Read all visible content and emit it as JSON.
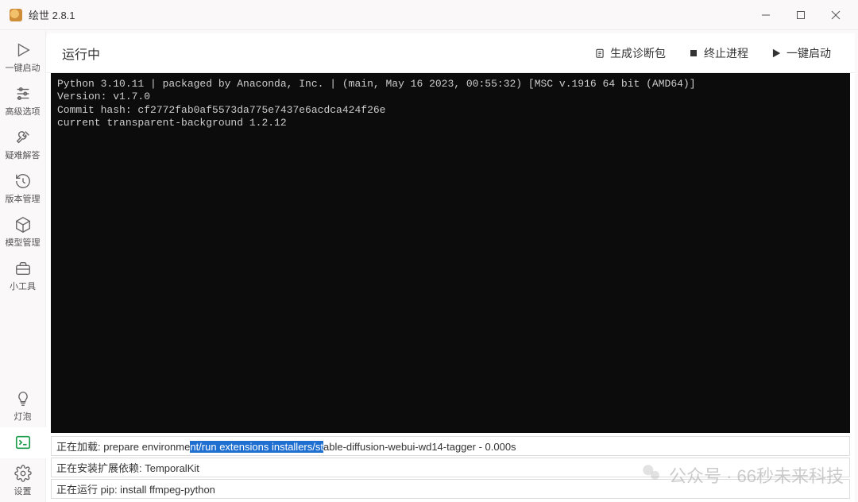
{
  "title": "绘世 2.8.1",
  "sidebar": {
    "items": [
      {
        "label": "一键启动"
      },
      {
        "label": "高级选项"
      },
      {
        "label": "疑难解答"
      },
      {
        "label": "版本管理"
      },
      {
        "label": "模型管理"
      },
      {
        "label": "小工具"
      },
      {
        "label": "灯泡"
      },
      {
        "label": ""
      },
      {
        "label": "设置"
      }
    ]
  },
  "toolbar": {
    "status": "运行中",
    "diagnose": "生成诊断包",
    "terminate": "终止进程",
    "launch": "一键启动"
  },
  "console": {
    "text": "Python 3.10.11 | packaged by Anaconda, Inc. | (main, May 16 2023, 00:55:32) [MSC v.1916 64 bit (AMD64)]\nVersion: v1.7.0\nCommit hash: cf2772fab0af5573da775e7437e6acdca424f26e\ncurrent transparent-background 1.2.12"
  },
  "status": {
    "line1_prefix": "正在加载: prepare environme",
    "line1_highlight": "nt/run extensions installers/st",
    "line1_suffix": "able-diffusion-webui-wd14-tagger - 0.000s",
    "line2": "正在安装扩展依赖: TemporalKit",
    "line3": "正在运行 pip: install ffmpeg-python"
  },
  "watermark": {
    "text": "公众号 · 66秒未来科技"
  }
}
